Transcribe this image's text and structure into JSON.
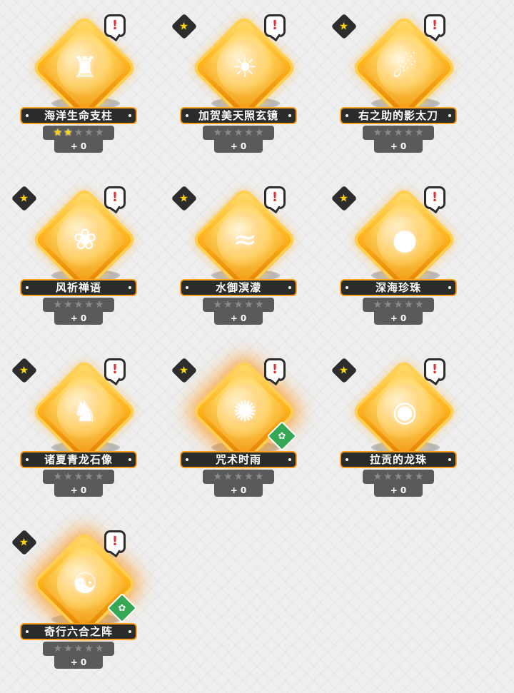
{
  "relics": [
    {
      "name": "海洋生命支柱",
      "stars_filled": 2,
      "level": "+ 0",
      "has_favorite": false,
      "has_alert": true,
      "has_element_badge": false,
      "icon": "pillar-icon",
      "glyph": "♜"
    },
    {
      "name": "加贺美天照玄镜",
      "stars_filled": 0,
      "level": "+ 0",
      "has_favorite": true,
      "has_alert": true,
      "has_element_badge": false,
      "icon": "mirror-icon",
      "glyph": "☀"
    },
    {
      "name": "右之助的影太刀",
      "stars_filled": 0,
      "level": "+ 0",
      "has_favorite": true,
      "has_alert": true,
      "has_element_badge": false,
      "icon": "blade-icon",
      "glyph": "☄"
    },
    {
      "name": "风祈禅语",
      "stars_filled": 0,
      "level": "+ 0",
      "has_favorite": true,
      "has_alert": true,
      "has_element_badge": false,
      "icon": "prayer-beads-icon",
      "glyph": "❀"
    },
    {
      "name": "水御溟濛",
      "stars_filled": 0,
      "level": "+ 0",
      "has_favorite": true,
      "has_alert": true,
      "has_element_badge": false,
      "icon": "water-wave-icon",
      "glyph": "≈"
    },
    {
      "name": "深海珍珠",
      "stars_filled": 0,
      "level": "+ 0",
      "has_favorite": true,
      "has_alert": true,
      "has_element_badge": false,
      "icon": "pearl-shell-icon",
      "glyph": "●"
    },
    {
      "name": "诸夏青龙石像",
      "stars_filled": 0,
      "level": "+ 0",
      "has_favorite": true,
      "has_alert": true,
      "has_element_badge": false,
      "icon": "dragon-statue-icon",
      "glyph": "♞"
    },
    {
      "name": "咒术时雨",
      "stars_filled": 0,
      "level": "+ 0",
      "has_favorite": true,
      "has_alert": true,
      "has_element_badge": true,
      "glow": true,
      "icon": "spirit-portrait-icon",
      "glyph": "✺"
    },
    {
      "name": "拉贡的龙珠",
      "stars_filled": 0,
      "level": "+ 0",
      "has_favorite": true,
      "has_alert": true,
      "has_element_badge": false,
      "icon": "dragon-orb-icon",
      "glyph": "◉"
    },
    {
      "name": "奇行六合之阵",
      "stars_filled": 0,
      "level": "+ 0",
      "has_favorite": true,
      "has_alert": true,
      "has_element_badge": true,
      "glow": true,
      "icon": "taiji-disc-icon",
      "glyph": "☯"
    }
  ],
  "badges": {
    "favorite_glyph": "★",
    "alert_glyph": "!",
    "element_glyph": "✿",
    "star_glyph": "★"
  },
  "colors": {
    "frame_gold": "#ffa21f",
    "label_dark": "#2b2b2b",
    "star_on": "#ffd400",
    "element_green": "#34a853",
    "alert_red": "#e0323c"
  }
}
